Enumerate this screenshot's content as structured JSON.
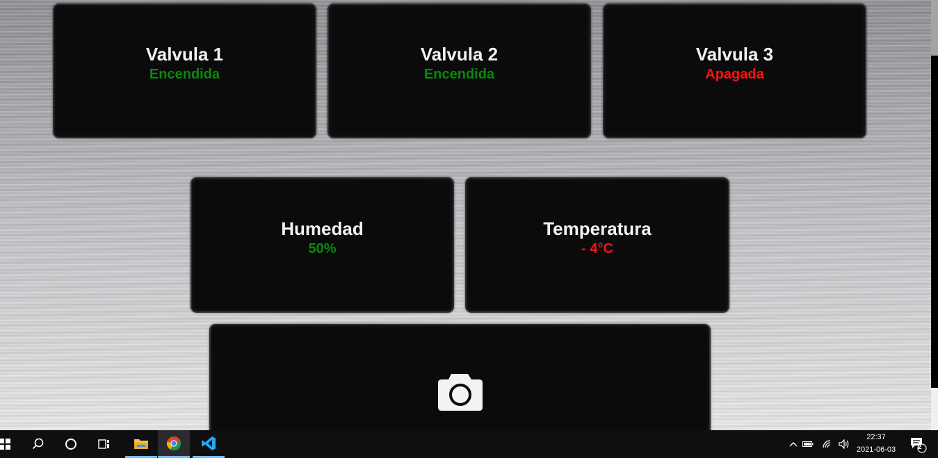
{
  "cards": {
    "valve1": {
      "title": "Valvula 1",
      "status": "Encendida",
      "status_color": "#0a8a0a"
    },
    "valve2": {
      "title": "Valvula 2",
      "status": "Encendida",
      "status_color": "#0a8a0a"
    },
    "valve3": {
      "title": "Valvula 3",
      "status": "Apagada",
      "status_color": "#ff1111"
    },
    "humidity": {
      "title": "Humedad",
      "value": "50%",
      "value_color": "#0a8a0a"
    },
    "temperature": {
      "title": "Temperatura",
      "value": "- 4°C",
      "value_color": "#ff1111"
    },
    "camera": {
      "icon": "camera-icon"
    }
  },
  "taskbar": {
    "icons": [
      "windows-start-icon",
      "search-icon",
      "cortana-icon",
      "task-view-icon",
      "file-explorer-icon",
      "chrome-icon",
      "vscode-icon"
    ],
    "tray_icons": [
      "chevron-up-icon",
      "battery-icon",
      "wifi-icon",
      "volume-icon",
      "notification-icon"
    ],
    "time": "22:37",
    "date": "2021-06-03",
    "notification_count": "2"
  }
}
